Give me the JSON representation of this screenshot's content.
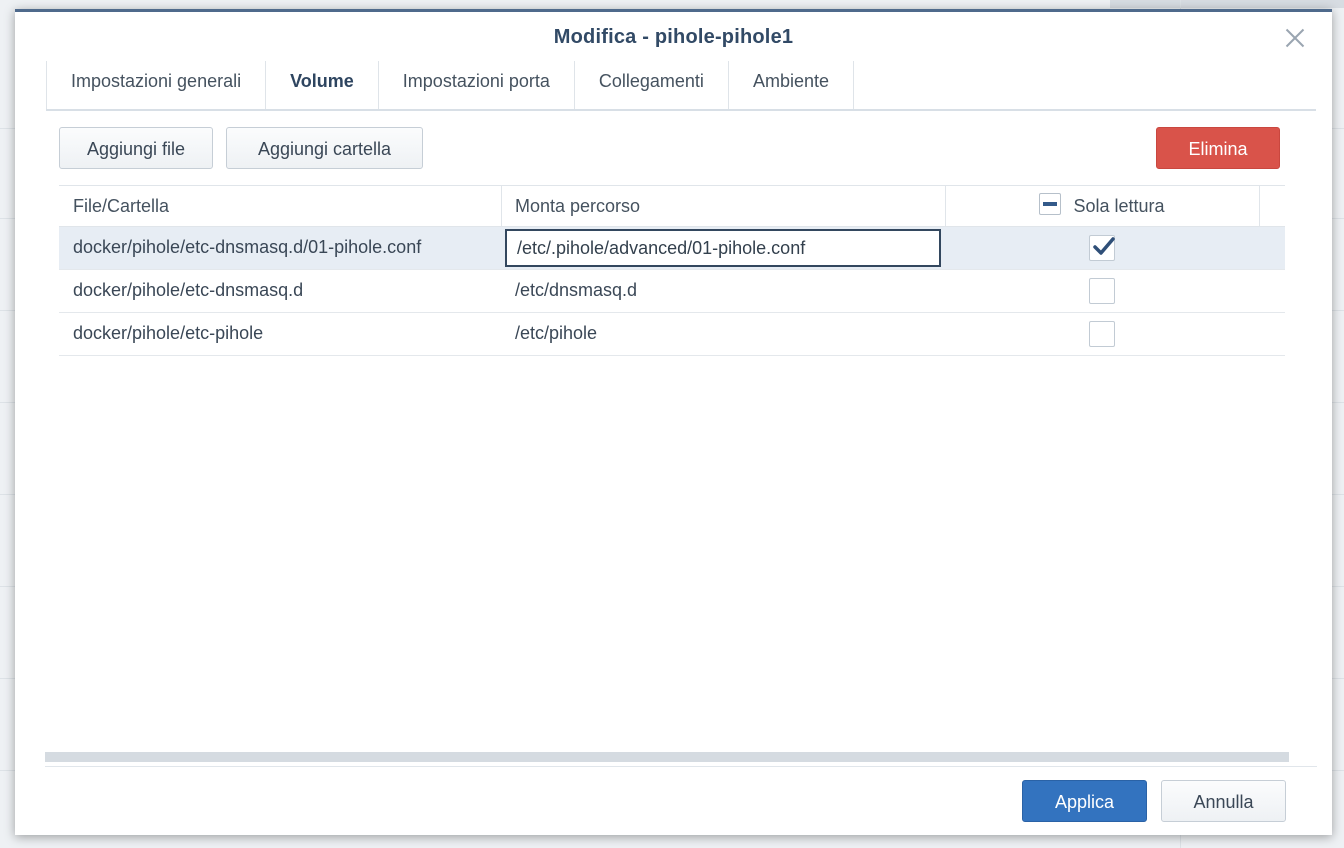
{
  "dialog": {
    "title": "Modifica - pihole-pihole1"
  },
  "tabs": [
    {
      "label": "Impostazioni generali",
      "active": false
    },
    {
      "label": "Volume",
      "active": true
    },
    {
      "label": "Impostazioni porta",
      "active": false
    },
    {
      "label": "Collegamenti",
      "active": false
    },
    {
      "label": "Ambiente",
      "active": false
    }
  ],
  "toolbar": {
    "add_file": "Aggiungi file",
    "add_folder": "Aggiungi cartella",
    "delete": "Elimina"
  },
  "table": {
    "columns": [
      "File/Cartella",
      "Monta percorso",
      "Sola lettura"
    ],
    "header_readonly_state": "indeterminate",
    "rows": [
      {
        "file": "docker/pihole/etc-dnsmasq.d/01-pihole.conf",
        "mount": "/etc/.pihole/advanced/01-pihole.conf",
        "readonly": true,
        "selected": true,
        "editing": true
      },
      {
        "file": "docker/pihole/etc-dnsmasq.d",
        "mount": "/etc/dnsmasq.d",
        "readonly": false,
        "selected": false,
        "editing": false
      },
      {
        "file": "docker/pihole/etc-pihole",
        "mount": "/etc/pihole",
        "readonly": false,
        "selected": false,
        "editing": false
      }
    ]
  },
  "footer": {
    "apply": "Applica",
    "cancel": "Annulla"
  },
  "colors": {
    "accent": "#3373bf",
    "danger": "#d9534a",
    "title": "#324a66",
    "selected_row": "#e7edf4"
  }
}
